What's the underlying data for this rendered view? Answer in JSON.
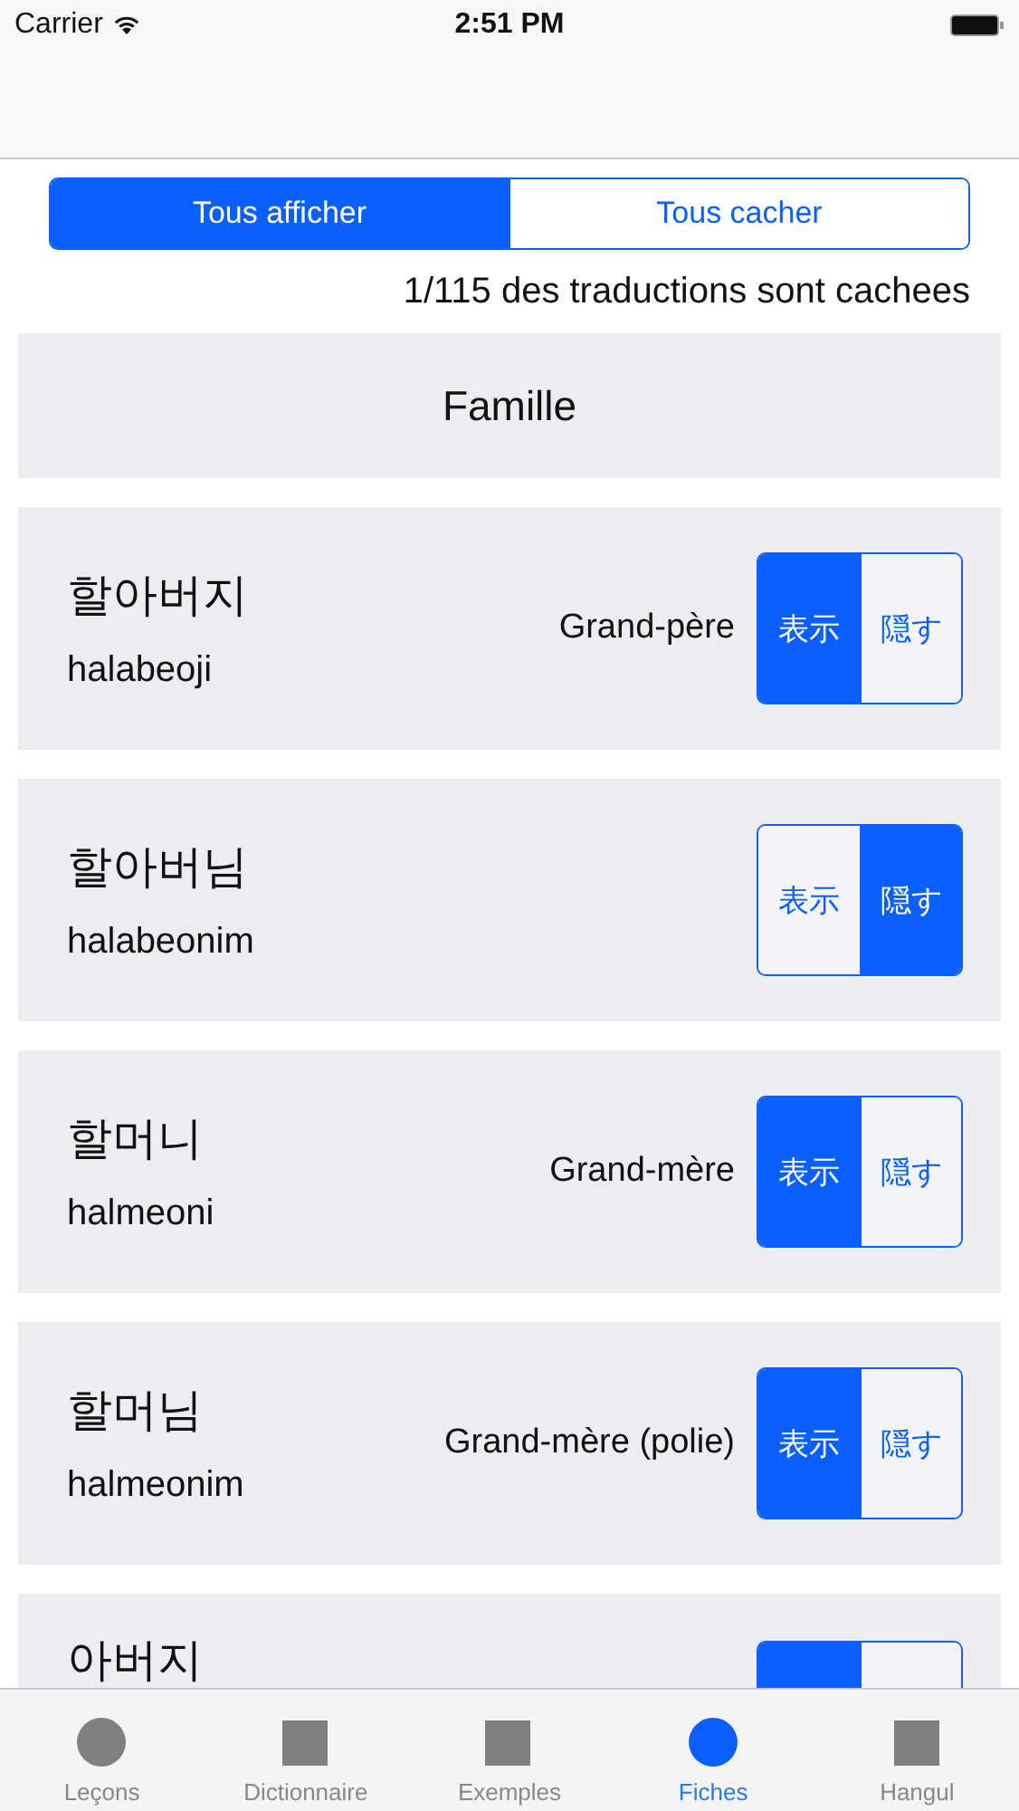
{
  "status_bar": {
    "carrier": "Carrier",
    "time": "2:51 PM"
  },
  "filter": {
    "segments": [
      {
        "label": "Tous afficher",
        "selected": true
      },
      {
        "label": "Tous cacher",
        "selected": false
      }
    ]
  },
  "count": "1/115 des traductions sont cachees",
  "section": "Famille",
  "cards": [
    {
      "korean": "할아버지",
      "romanization": "halabeoji",
      "translation": "Grand-père",
      "toggle": [
        {
          "label": "表示",
          "selected": true
        },
        {
          "label": "隠す",
          "selected": false
        }
      ]
    },
    {
      "korean": "할아버님",
      "romanization": "halabeonim",
      "toggle": [
        {
          "label": "表示",
          "selected": false
        },
        {
          "label": "隠す",
          "selected": true
        }
      ]
    },
    {
      "korean": "할머니",
      "romanization": "halmeoni",
      "translation": "Grand-mère",
      "toggle": [
        {
          "label": "表示",
          "selected": true
        },
        {
          "label": "隠す",
          "selected": false
        }
      ]
    },
    {
      "korean": "할머님",
      "romanization": "halmeonim",
      "translation": "Grand-mère (polie)",
      "toggle": [
        {
          "label": "表示",
          "selected": true
        },
        {
          "label": "隠す",
          "selected": false
        }
      ]
    },
    {
      "korean": "아버지",
      "toggle": [
        {
          "selected": true
        },
        {
          "selected": false
        }
      ]
    }
  ],
  "tab_bar": [
    {
      "label": "Leçons",
      "kind": "circle",
      "selected": false
    },
    {
      "label": "Dictionnaire",
      "kind": "square",
      "selected": false
    },
    {
      "label": "Exemples",
      "kind": "square",
      "selected": false
    },
    {
      "label": "Fiches",
      "kind": "circle",
      "selected": true
    },
    {
      "label": "Hangul",
      "kind": "square",
      "selected": false
    }
  ]
}
